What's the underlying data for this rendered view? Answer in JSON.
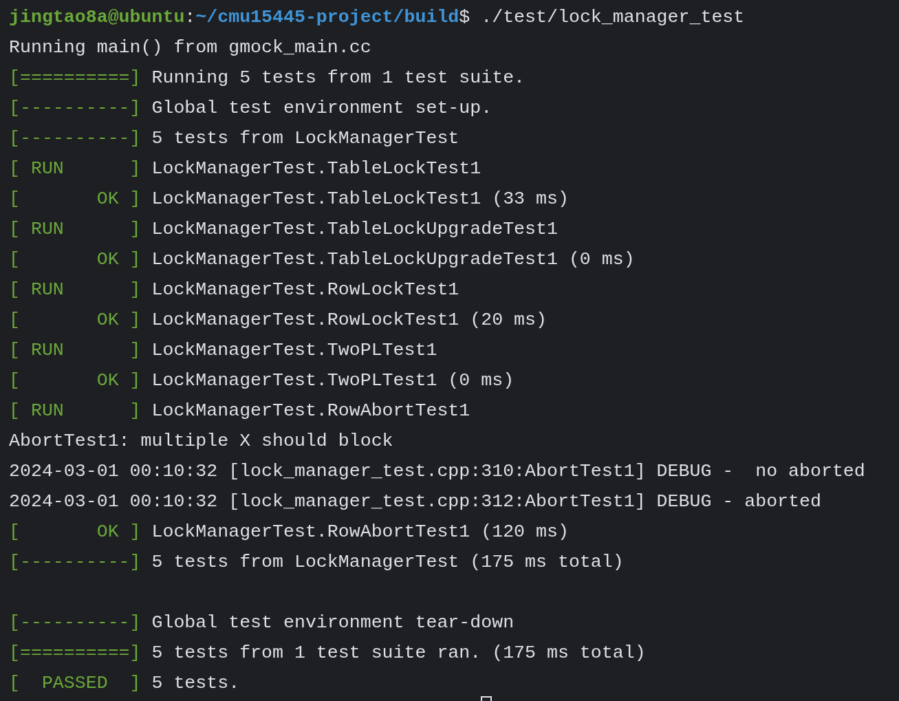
{
  "lines": [
    {
      "kind": "text",
      "segments": [
        {
          "kind": "user",
          "text": "jingtao8a@ubuntu"
        },
        {
          "kind": "plain",
          "text": ":"
        },
        {
          "kind": "path",
          "text": "~/cmu15445-project/build"
        },
        {
          "kind": "plain",
          "text": "$ ./test/lock_manager_test"
        }
      ]
    },
    {
      "kind": "text",
      "segments": [
        {
          "kind": "plain",
          "text": "Running main() from gmock_main.cc"
        }
      ]
    },
    {
      "kind": "text",
      "segments": [
        {
          "kind": "tag",
          "text": "[==========]"
        },
        {
          "kind": "plain",
          "text": " Running 5 tests from 1 test suite."
        }
      ]
    },
    {
      "kind": "text",
      "segments": [
        {
          "kind": "tag",
          "text": "[----------]"
        },
        {
          "kind": "plain",
          "text": " Global test environment set-up."
        }
      ]
    },
    {
      "kind": "text",
      "segments": [
        {
          "kind": "tag",
          "text": "[----------]"
        },
        {
          "kind": "plain",
          "text": " 5 tests from LockManagerTest"
        }
      ]
    },
    {
      "kind": "text",
      "segments": [
        {
          "kind": "tag",
          "text": "[ RUN      ]"
        },
        {
          "kind": "plain",
          "text": " LockManagerTest.TableLockTest1"
        }
      ]
    },
    {
      "kind": "text",
      "segments": [
        {
          "kind": "tag",
          "text": "[       OK ]"
        },
        {
          "kind": "plain",
          "text": " LockManagerTest.TableLockTest1 (33 ms)"
        }
      ]
    },
    {
      "kind": "text",
      "segments": [
        {
          "kind": "tag",
          "text": "[ RUN      ]"
        },
        {
          "kind": "plain",
          "text": " LockManagerTest.TableLockUpgradeTest1"
        }
      ]
    },
    {
      "kind": "text",
      "segments": [
        {
          "kind": "tag",
          "text": "[       OK ]"
        },
        {
          "kind": "plain",
          "text": " LockManagerTest.TableLockUpgradeTest1 (0 ms)"
        }
      ]
    },
    {
      "kind": "text",
      "segments": [
        {
          "kind": "tag",
          "text": "[ RUN      ]"
        },
        {
          "kind": "plain",
          "text": " LockManagerTest.RowLockTest1"
        }
      ]
    },
    {
      "kind": "text",
      "segments": [
        {
          "kind": "tag",
          "text": "[       OK ]"
        },
        {
          "kind": "plain",
          "text": " LockManagerTest.RowLockTest1 (20 ms)"
        }
      ]
    },
    {
      "kind": "text",
      "segments": [
        {
          "kind": "tag",
          "text": "[ RUN      ]"
        },
        {
          "kind": "plain",
          "text": " LockManagerTest.TwoPLTest1"
        }
      ]
    },
    {
      "kind": "text",
      "segments": [
        {
          "kind": "tag",
          "text": "[       OK ]"
        },
        {
          "kind": "plain",
          "text": " LockManagerTest.TwoPLTest1 (0 ms)"
        }
      ]
    },
    {
      "kind": "text",
      "segments": [
        {
          "kind": "tag",
          "text": "[ RUN      ]"
        },
        {
          "kind": "plain",
          "text": " LockManagerTest.RowAbortTest1"
        }
      ]
    },
    {
      "kind": "text",
      "segments": [
        {
          "kind": "plain",
          "text": "AbortTest1: multiple X should block"
        }
      ]
    },
    {
      "kind": "text",
      "segments": [
        {
          "kind": "plain",
          "text": "2024-03-01 00:10:32 [lock_manager_test.cpp:310:AbortTest1] DEBUG -  no aborted"
        }
      ]
    },
    {
      "kind": "text",
      "segments": [
        {
          "kind": "plain",
          "text": "2024-03-01 00:10:32 [lock_manager_test.cpp:312:AbortTest1] DEBUG - aborted"
        }
      ]
    },
    {
      "kind": "text",
      "segments": [
        {
          "kind": "tag",
          "text": "[       OK ]"
        },
        {
          "kind": "plain",
          "text": " LockManagerTest.RowAbortTest1 (120 ms)"
        }
      ]
    },
    {
      "kind": "text",
      "segments": [
        {
          "kind": "tag",
          "text": "[----------]"
        },
        {
          "kind": "plain",
          "text": " 5 tests from LockManagerTest (175 ms total)"
        }
      ]
    },
    {
      "kind": "blank"
    },
    {
      "kind": "text",
      "segments": [
        {
          "kind": "tag",
          "text": "[----------]"
        },
        {
          "kind": "plain",
          "text": " Global test environment tear-down"
        }
      ]
    },
    {
      "kind": "text",
      "segments": [
        {
          "kind": "tag",
          "text": "[==========]"
        },
        {
          "kind": "plain",
          "text": " 5 tests from 1 test suite ran. (175 ms total)"
        }
      ]
    },
    {
      "kind": "text",
      "segments": [
        {
          "kind": "tag",
          "text": "[  PASSED  ]"
        },
        {
          "kind": "plain",
          "text": " 5 tests."
        }
      ]
    }
  ]
}
